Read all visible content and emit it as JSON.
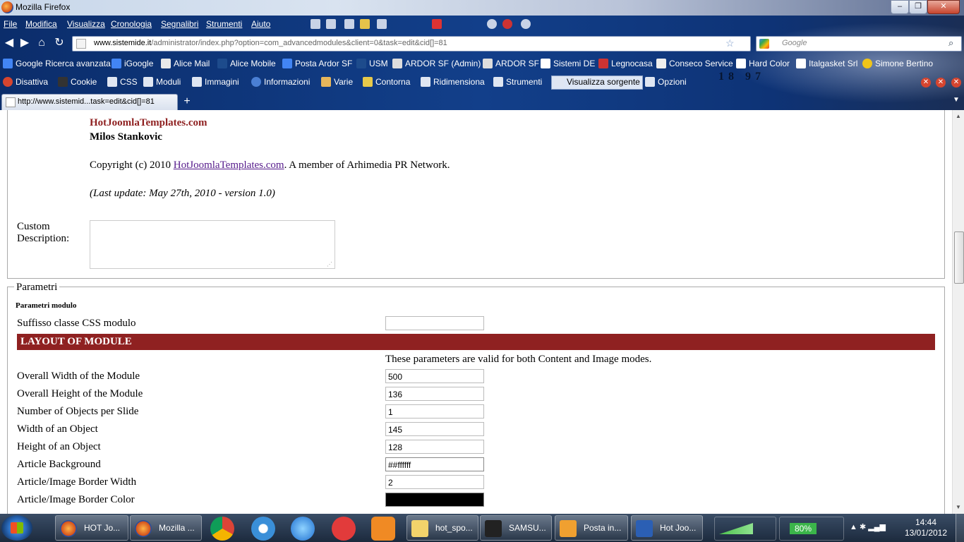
{
  "window": {
    "title": "Mozilla Firefox"
  },
  "menu": [
    "File",
    "Modifica",
    "Visualizza",
    "Cronologia",
    "Segnalibri",
    "Strumenti",
    "Aiuto"
  ],
  "nav": {
    "url_host": "www.sistemide.it",
    "url_path": "/administrator/index.php?option=com_advancedmodules&client=0&task=edit&cid[]=81",
    "search_placeholder": "Google"
  },
  "bookmarks": [
    "Google Ricerca avanzata",
    "iGoogle",
    "Alice Mail",
    "Alice Mobile",
    "Posta Ardor SF",
    "USM",
    "ARDOR SF (Admin)",
    "ARDOR SF",
    "Sistemi DE",
    "Legnocasa",
    "Conseco Service",
    "Hard Color",
    "Italgasket Srl",
    "Simone Bertino"
  ],
  "devtoolbar": [
    "Disattiva",
    "Cookie",
    "CSS",
    "Moduli",
    "Immagini",
    "Informazioni",
    "Varie",
    "Contorna",
    "Ridimensiona",
    "Strumenti",
    "Visualizza sorgente",
    "Opzioni"
  ],
  "tab": {
    "title": "http://www.sistemid...task=edit&cid[]=81"
  },
  "page": {
    "site_link": "HotJoomlaTemplates.com",
    "author": "Milos Stankovic",
    "copyright_prefix": "Copyright (c) 2010 ",
    "copyright_link": "HotJoomlaTemplates.com",
    "copyright_suffix": ". A member of Arhimedia PR Network.",
    "last_update": "(Last update: May 27th, 2010 - version 1.0)",
    "custom_description_label_1": "Custom",
    "custom_description_label_2": "Description:",
    "params_legend": "Parametri",
    "params_subtitle": "Parametri modulo",
    "css_suffix_label": "Suffisso classe CSS modulo",
    "layout_header": "LAYOUT OF MODULE",
    "layout_note": "These parameters are valid for both Content and Image modes.",
    "fields": [
      {
        "label": "Overall Width of the Module",
        "value": "500"
      },
      {
        "label": "Overall Height of the Module",
        "value": "136"
      },
      {
        "label": "Number of Objects per Slide",
        "value": "1"
      },
      {
        "label": "Width of an Object",
        "value": "145"
      },
      {
        "label": "Height of an Object",
        "value": "128"
      },
      {
        "label": "Article Background",
        "value": "##ffffff"
      },
      {
        "label": "Article/Image Border Width",
        "value": "2"
      },
      {
        "label": "Article/Image Border Color",
        "value": ""
      }
    ]
  },
  "taskbar": {
    "items": [
      "HOT Jo...",
      "Mozilla ...",
      "hot_spo...",
      "SAMSU...",
      "Posta in...",
      "Hot Joo..."
    ],
    "battery": "80%",
    "time": "14:44",
    "date": "13/01/2012"
  },
  "colors": {
    "accent_header": "#8f2121",
    "link": "#8f2121"
  }
}
